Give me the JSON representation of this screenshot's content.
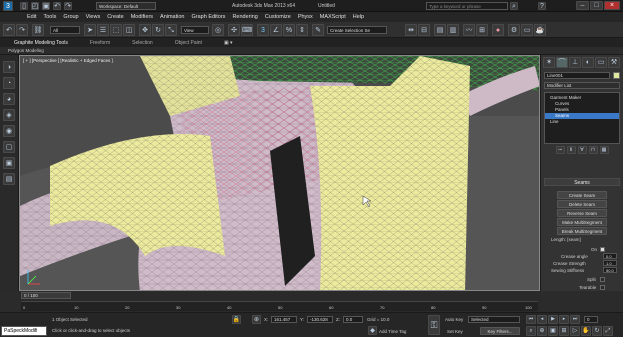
{
  "app": {
    "workspace": "Workspace: Default",
    "title": "Autodesk 3ds Max 2013 x64",
    "doc_title": "Untitled",
    "search_placeholder": "Type a keyword or phrase"
  },
  "menu": [
    "Edit",
    "Tools",
    "Group",
    "Views",
    "Create",
    "Modifiers",
    "Animation",
    "Graph Editors",
    "Rendering",
    "Customize",
    "Physx",
    "MAXScript",
    "Help"
  ],
  "toolbar": {
    "selection_filter": "All",
    "ref_coord": "View",
    "named_selection": "Create Selection Se"
  },
  "ribbon": {
    "tabs": [
      "Graphite Modeling Tools",
      "Freeform",
      "Selection",
      "Object Paint"
    ],
    "subtab": "Polygon Modeling"
  },
  "viewport": {
    "label": "[ + ] [Perspective ] [Realistic + Edged Faces ]"
  },
  "command_panel": {
    "object_name": "Line001",
    "modifier_list": "Modifier List",
    "stack": [
      "Garment Maker",
      "Curves",
      "Panels",
      "Seams",
      "Line"
    ],
    "selected_stack_item": "Seams",
    "rollout_title": "Seams",
    "buttons": [
      "Create Seam",
      "Delete Seam",
      "Reverse Seam",
      "Make MultiSegment",
      "Break MultiSegment"
    ],
    "length_label": "Length: [seam]",
    "on_label": "On",
    "crease_angle_label": "Crease angle",
    "crease_angle": "0.0",
    "crease_strength_label": "Crease Strength",
    "crease_strength": "1.0",
    "sewing_stiffness_label": "Sewing Stiffness",
    "sewing_stiffness": "50.0",
    "split_label": "Split",
    "tearable_label": "Tearable",
    "tear_threshold_label": "Tear Threshold",
    "tear_threshold": "10.0"
  },
  "timeline": {
    "frame_label": "0 / 100",
    "ticks": [
      "0",
      "10",
      "20",
      "30",
      "40",
      "50",
      "60",
      "70",
      "80",
      "90",
      "100"
    ]
  },
  "status": {
    "maxscript": "PaSpeckModifi",
    "selected": "1 Object Selected",
    "prompt": "Click or click-and-drag to select objects",
    "x_label": "X:",
    "x_value": "161.457",
    "y_label": "Y:",
    "y_value": "-130.628",
    "z_label": "Z:",
    "z_value": "0.0",
    "grid": "Grid = 10.0",
    "add_time_tag": "Add Time Tag",
    "auto_key": "Auto Key",
    "set_key": "Set Key",
    "key_mode": "Selected",
    "key_filters": "Key Filters...",
    "current_frame": "0"
  }
}
